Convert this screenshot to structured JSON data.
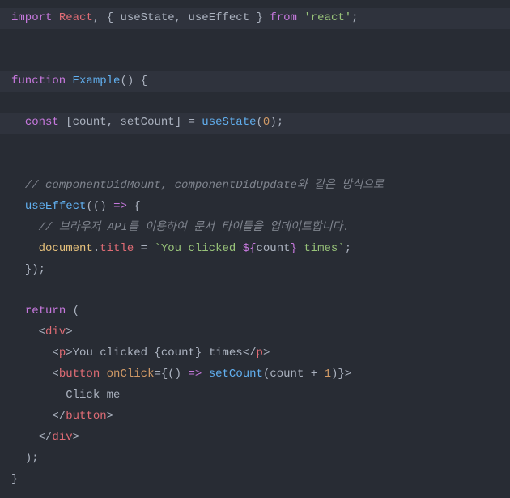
{
  "code": {
    "l1_import": "import",
    "l1_react": "React",
    "l1_us": "useState",
    "l1_ue": "useEffect",
    "l1_from": "from",
    "l1_mod": "'react'",
    "l3_fn": "function",
    "l3_name": "Example",
    "l4_const": "const",
    "l4_count": "count",
    "l4_setcount": "setCount",
    "l4_us": "useState",
    "l4_zero": "0",
    "l6_cmt": "// componentDidMount, componentDidUpdate와 같은 방식으로",
    "l7_ue": "useEffect",
    "l8_cmt": "// 브라우저 API를 이용하여 문서 타이틀을 업데이트합니다.",
    "l9_doc": "document",
    "l9_title": "title",
    "l9_str1": "`You clicked ",
    "l9_count": "count",
    "l9_str2": " times`",
    "l12_return": "return",
    "l13_div": "div",
    "l14_p": "p",
    "l14_txt1": "You clicked ",
    "l14_count": "count",
    "l14_txt2": " times",
    "l15_button": "button",
    "l15_onclick": "onClick",
    "l15_setcount": "setCount",
    "l15_count": "count",
    "l15_one": "1",
    "l16_txt": "Click me",
    "l17_button": "button",
    "l18_div": "div"
  }
}
